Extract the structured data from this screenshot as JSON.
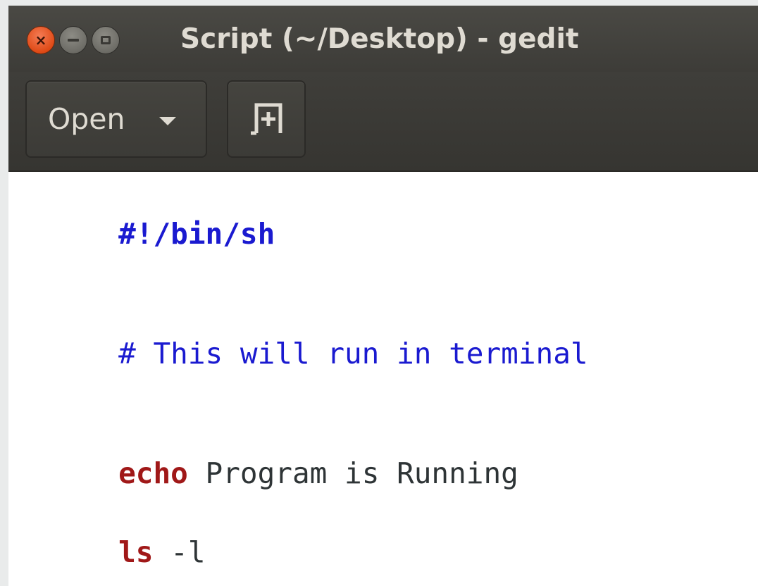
{
  "window": {
    "title": "Script (~/Desktop) - gedit",
    "controls": {
      "close_icon": "close-icon",
      "close_glyph": "×",
      "minimize_icon": "minimize-icon",
      "maximize_icon": "maximize-icon"
    }
  },
  "toolbar": {
    "open_label": "Open",
    "open_dropdown_icon": "chevron-down-icon",
    "new_document_icon": "new-document-icon"
  },
  "editor": {
    "lines": [
      {
        "tokens": [
          {
            "text": "#!/bin/sh",
            "kind": "shebang"
          }
        ]
      },
      {
        "tokens": []
      },
      {
        "tokens": [
          {
            "text": "# This will run in terminal",
            "kind": "comment"
          }
        ]
      },
      {
        "tokens": []
      },
      {
        "tokens": [
          {
            "text": "echo",
            "kind": "keyword"
          },
          {
            "text": " Program is Running",
            "kind": "plain"
          }
        ]
      },
      {
        "tokens": [
          {
            "text": "ls",
            "kind": "keyword"
          },
          {
            "text": " -l",
            "kind": "plain"
          }
        ]
      }
    ]
  },
  "colors": {
    "titlebar": "#3d3c38",
    "close_button": "#df4a16",
    "title_text": "#dfdbd2",
    "shebang_comment": "#1a1ad0",
    "keyword": "#a01818",
    "plain_text": "#2e3436",
    "editor_background": "#ffffff"
  }
}
